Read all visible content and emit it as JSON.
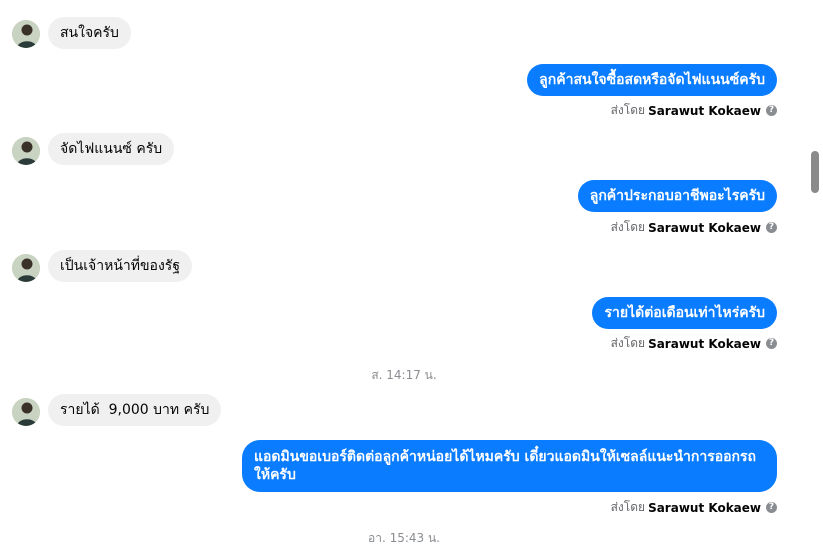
{
  "messages": [
    {
      "from": "customer",
      "text": "สนใจครับ"
    },
    {
      "from": "page",
      "text": "ลูกค้าสนใจซื้อสดหรือจัดไฟแนนซ์ครับ",
      "sent_by_label": "ส่งโดย",
      "sent_by_name": "Sarawut Kokaew"
    },
    {
      "from": "customer",
      "text": "จัดไฟแนนซ์ ครับ"
    },
    {
      "from": "page",
      "text": "ลูกค้าประกอบอาชีพอะไรครับ",
      "sent_by_label": "ส่งโดย",
      "sent_by_name": "Sarawut Kokaew"
    },
    {
      "from": "customer",
      "text": "เป็นเจ้าหน้าที่ของรัฐ"
    },
    {
      "from": "page",
      "text": "รายได้ต่อเดือนเท่าไหร่ครับ",
      "sent_by_label": "ส่งโดย",
      "sent_by_name": "Sarawut Kokaew"
    },
    {
      "from": "system",
      "text": "ส. 14:17 น."
    },
    {
      "from": "customer",
      "text": "รายได้  9,000 บาท ครับ"
    },
    {
      "from": "page",
      "text": "แอดมินขอเบอร์ติดต่อลูกค้าหน่อยได้ไหมครับ เดี๋ยวแอดมินให้เซลล์แนะนำการออกรถให้ครับ",
      "sent_by_label": "ส่งโดย",
      "sent_by_name": "Sarawut Kokaew"
    },
    {
      "from": "system",
      "text": "อา. 15:43 น."
    }
  ],
  "help_icon_glyph": "?",
  "colors": {
    "outgoing_bubble": "#0a7cff",
    "incoming_bubble": "#f0f0f0",
    "timestamp": "#8a8d91"
  }
}
